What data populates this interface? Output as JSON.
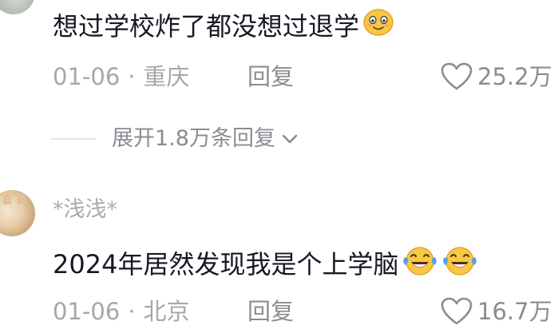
{
  "comments": [
    {
      "text": "想过学校炸了都没想过退学",
      "emojis": [
        "smile-emoji"
      ],
      "date": "01-06",
      "location": "重庆",
      "reply_label": "回复",
      "likes": "25.2万"
    },
    {
      "username": "*浅浅*",
      "text": "2024年居然发现我是个上学脑",
      "emojis": [
        "laugh-cry-emoji",
        "laugh-cry-emoji"
      ],
      "date": "01-06",
      "location": "北京",
      "reply_label": "回复",
      "likes": "16.7万"
    }
  ],
  "expand": {
    "label": "展开1.8万条回复"
  },
  "separator": "·"
}
